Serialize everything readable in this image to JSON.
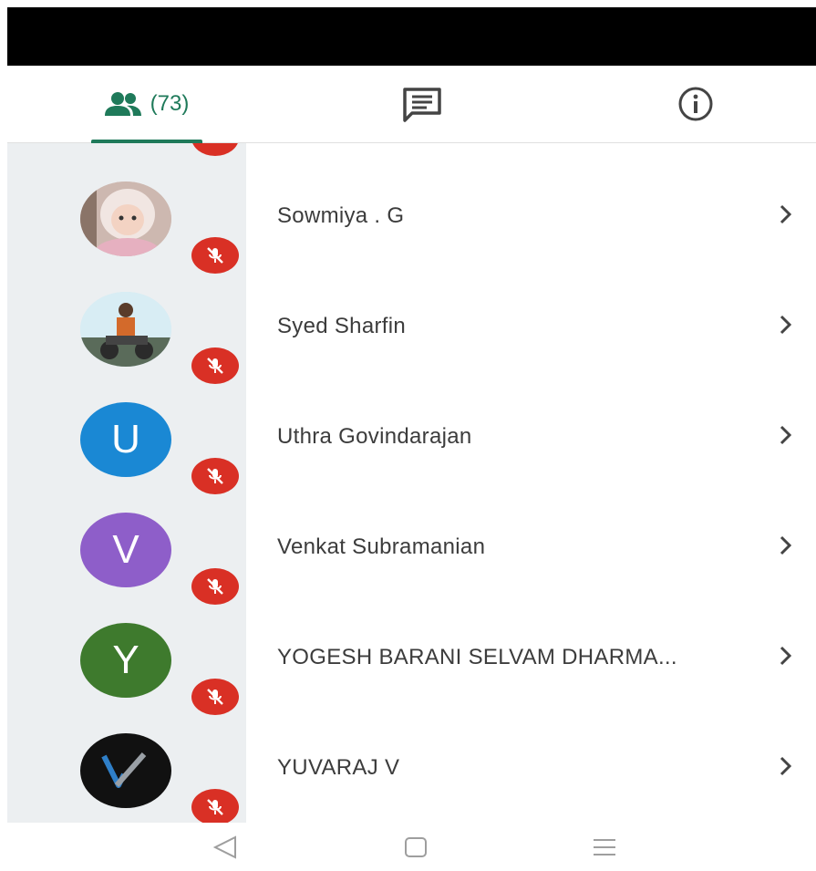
{
  "tabs": {
    "people_count": "(73)",
    "people_icon": "people-icon",
    "chat_icon": "chat-icon",
    "info_icon": "info-icon",
    "accent": "#1f7a5a"
  },
  "participants": [
    {
      "name": "Sowmiya . G",
      "avatar": "photo",
      "muted": true
    },
    {
      "name": "Syed Sharfin",
      "avatar": "photo",
      "muted": true
    },
    {
      "name": "Uthra Govindarajan",
      "avatar_letter": "U",
      "avatar_color": "#1a88d4",
      "muted": true
    },
    {
      "name": "Venkat Subramanian",
      "avatar_letter": "V",
      "avatar_color": "#8e5ec9",
      "muted": true
    },
    {
      "name": "YOGESH BARANI SELVAM DHARMA...",
      "avatar_letter": "Y",
      "avatar_color": "#3e7a2d",
      "muted": true
    },
    {
      "name": "YUVARAJ V",
      "avatar": "logo",
      "muted": true
    }
  ],
  "colors": {
    "mute_badge": "#d93025",
    "left_strip": "#eceff1"
  },
  "nav": {
    "back_icon": "back-triangle-icon",
    "home_icon": "home-square-icon",
    "menu_icon": "menu-lines-icon"
  }
}
